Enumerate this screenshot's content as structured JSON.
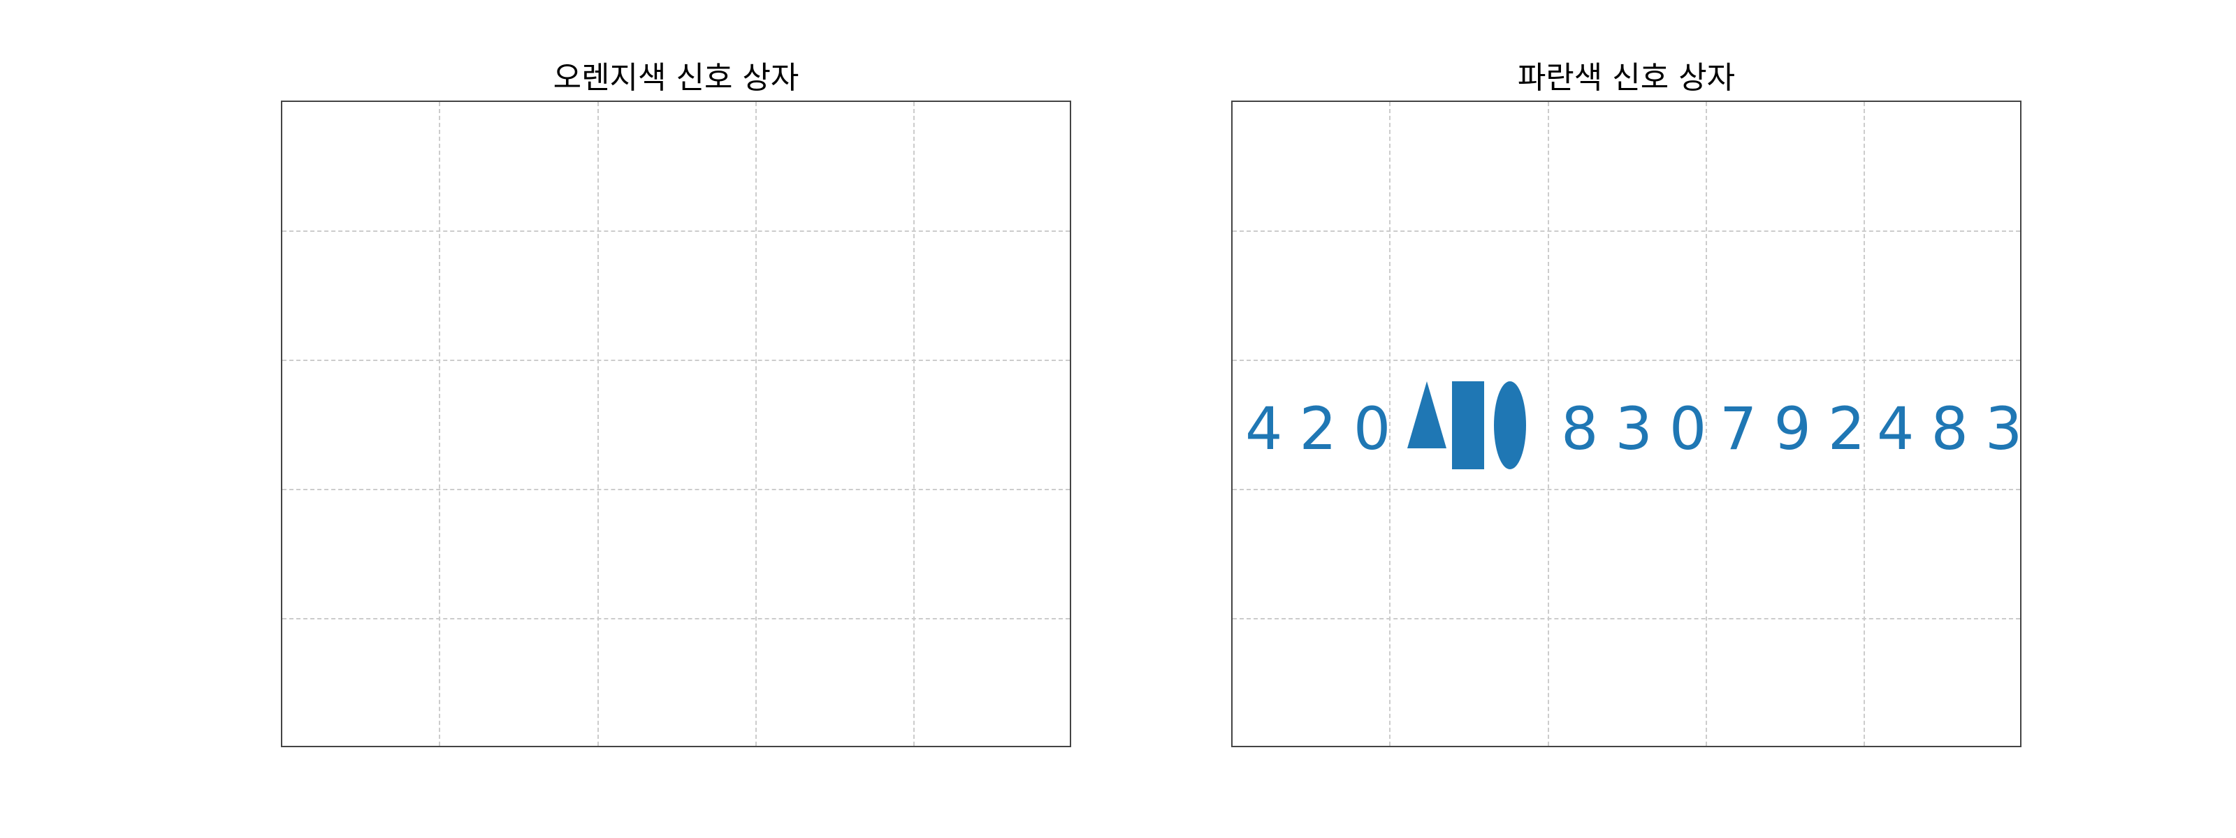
{
  "panels": {
    "orange": {
      "title": "오렌지색 신호 상자"
    },
    "blue": {
      "title": "파란색 신호 상자",
      "signal_color": "#1f77b4",
      "numbers": [
        "420",
        "830",
        "792",
        "483"
      ],
      "shapes": [
        "triangle",
        "rectangle",
        "ellipse"
      ]
    }
  },
  "colors": {
    "grid": "#cccccc",
    "frame": "#444444",
    "signal": "#1f77b4"
  }
}
